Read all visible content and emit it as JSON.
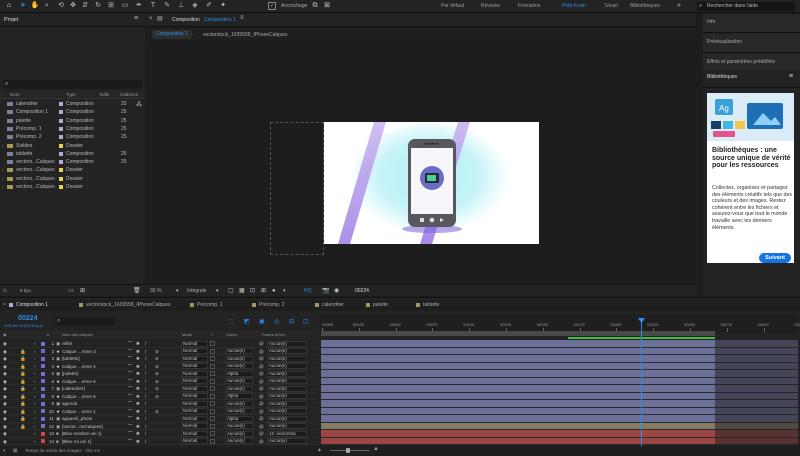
{
  "toolbar": {
    "snap_label": "Accrochage",
    "workspaces": [
      "Par défaut",
      "Révision",
      "Formation",
      "Petit écran",
      "Usuel",
      "Bibliothèques"
    ],
    "search_placeholder": "Rechercher dans l'aide"
  },
  "project": {
    "title": "Projet",
    "columns": {
      "name": "Nom",
      "type": "Type",
      "size": "Taille",
      "rate": "Cadence"
    },
    "items": [
      {
        "name": "calendrier",
        "type": "Composition",
        "rate": "25",
        "color": "#b6a7d9"
      },
      {
        "name": "Composition 1",
        "type": "Composition",
        "rate": "25",
        "color": "#b6a7d9"
      },
      {
        "name": "palette",
        "type": "Composition",
        "rate": "25",
        "color": "#b6a7d9"
      },
      {
        "name": "Précomp. 1",
        "type": "Composition",
        "rate": "25",
        "color": "#b6a7d9"
      },
      {
        "name": "Précomp. 2",
        "type": "Composition",
        "rate": "25",
        "color": "#b6a7d9"
      },
      {
        "name": "Solides",
        "type": "Dossier",
        "rate": "",
        "color": "#e6d34e"
      },
      {
        "name": "tablette",
        "type": "Composition",
        "rate": "25",
        "color": "#b6a7d9"
      },
      {
        "name": "vectors...Calques",
        "type": "Composition",
        "rate": "25",
        "color": "#b6a7d9"
      },
      {
        "name": "vectors...Calques",
        "type": "Dossier",
        "rate": "",
        "color": "#e6d34e"
      },
      {
        "name": "vectors...Calques",
        "type": "Dossier",
        "rate": "",
        "color": "#e6d34e"
      },
      {
        "name": "vectors...Calques",
        "type": "Dossier",
        "rate": "",
        "color": "#e6d34e"
      }
    ],
    "bpc": "8 bpc"
  },
  "viewer": {
    "tab_prefix": "Composition",
    "tab_name": "Composition 1",
    "breadcrumbs": [
      "Composition 1",
      "vectorstock_1639558_IPhoneCalques"
    ],
    "zoom": "30 %",
    "resolution": "Intégrale",
    "timecode": "00224"
  },
  "right_panel": {
    "sections": [
      "Info",
      "Prévisualisation",
      "Effets et paramètres prédéfinis"
    ],
    "libraries_title": "Bibliothèques",
    "lib_heading": "Bibliothèques : une source unique de vérité pour les ressources",
    "lib_body": "Collectez, organisez et partagez des éléments créatifs tels que des couleurs et des images. Restez cohérent entre les fichiers et assurez-vous que tout le monde travaille avec les derniers éléments.",
    "next_button": "Suivant"
  },
  "timeline": {
    "tabs": [
      {
        "label": "Composition 1",
        "color": "#b6a7d9"
      },
      {
        "label": "vectorstock_1639558_IPhoneCalques",
        "color": "#b6a7d9"
      },
      {
        "label": "Précomp. 1",
        "color": "#b6a7d9"
      },
      {
        "label": "Précomp. 2",
        "color": "#b6a7d9"
      },
      {
        "label": "calendrier",
        "color": "#b6a7d9"
      },
      {
        "label": "palette",
        "color": "#b6a7d9"
      },
      {
        "label": "tablette",
        "color": "#b6a7d9"
      }
    ],
    "timecode": "00224",
    "timecode_sub": "0:00:08:24 (25.00 ips)",
    "columns": {
      "name": "Nom des calques",
      "mode": "Mode",
      "t": "T",
      "cache": "Cache",
      "parent": "Parent et lien"
    },
    "ruler": [
      "00000",
      "00025",
      "00050",
      "00075",
      "00100",
      "00125",
      "00150",
      "00175",
      "00200",
      "00225",
      "00250",
      "00275",
      "00300",
      "00325"
    ],
    "layers": [
      {
        "num": "1",
        "name": "reflet",
        "mode": "Normal",
        "cache": "",
        "parent": "Aucun(e)",
        "label": "#6f6fcf"
      },
      {
        "num": "2",
        "name": "Calque ...mme 3",
        "mode": "Normal",
        "cache": "Aucun(e)",
        "parent": "Aucun(e)",
        "label": "#6f6fcf"
      },
      {
        "num": "3",
        "name": "[tablette]",
        "mode": "Normal",
        "cache": "Aucun(e)",
        "parent": "Aucun(e)",
        "label": "#6f6fcf"
      },
      {
        "num": "4",
        "name": "Calque ...mme 4",
        "mode": "Normal",
        "cache": "Aucun(e)",
        "parent": "Aucun(e)",
        "label": "#6f6fcf"
      },
      {
        "num": "5",
        "name": "[palette]",
        "mode": "Normal",
        "cache": "Alpha",
        "parent": "Aucun(e)",
        "label": "#6f6fcf"
      },
      {
        "num": "6",
        "name": "Calque ...mme 5",
        "mode": "Normal",
        "cache": "Aucun(e)",
        "parent": "Aucun(e)",
        "label": "#6f6fcf"
      },
      {
        "num": "7",
        "name": "[calendrier]",
        "mode": "Normal",
        "cache": "Aucun(e)",
        "parent": "Aucun(e)",
        "label": "#6f6fcf"
      },
      {
        "num": "8",
        "name": "Calque ...mme 6",
        "mode": "Normal",
        "cache": "Alpha",
        "parent": "Aucun(e)",
        "label": "#6f6fcf"
      },
      {
        "num": "9",
        "name": "agenda",
        "mode": "Normal",
        "cache": "Aucun(e)",
        "parent": "Aucun(e)",
        "label": "#6f6fcf"
      },
      {
        "num": "10",
        "name": "Calque ...mme 1",
        "mode": "Normal",
        "cache": "Aucun(e)",
        "parent": "Aucun(e)",
        "label": "#6f6fcf"
      },
      {
        "num": "11",
        "name": "appareil_photo",
        "mode": "Normal",
        "cache": "Alpha",
        "parent": "Aucun(e)",
        "label": "#6f6fcf"
      },
      {
        "num": "12",
        "name": "[vector...neCalques]",
        "mode": "Normal",
        "cache": "Aucun(e)",
        "parent": "Aucun(e)",
        "label": "#6f6fcf"
      },
      {
        "num": "13",
        "name": "[Bleu sombre uni 1]",
        "mode": "Normal",
        "cache": "Aucun(e)",
        "parent": "12. vectorstoc",
        "label": "#cc4444"
      },
      {
        "num": "14",
        "name": "[Bleu roi uni 1]",
        "mode": "Normal",
        "cache": "Aucun(e)",
        "parent": "Aucun(e)",
        "label": "#cc4444"
      }
    ],
    "render_time": "Temps de rendu des images : 302 ms"
  },
  "colors": {
    "accent": "#2d8ceb",
    "track_purple": "#6c6f98",
    "track_tan": "#867c64",
    "track_red": "#9b4545"
  }
}
